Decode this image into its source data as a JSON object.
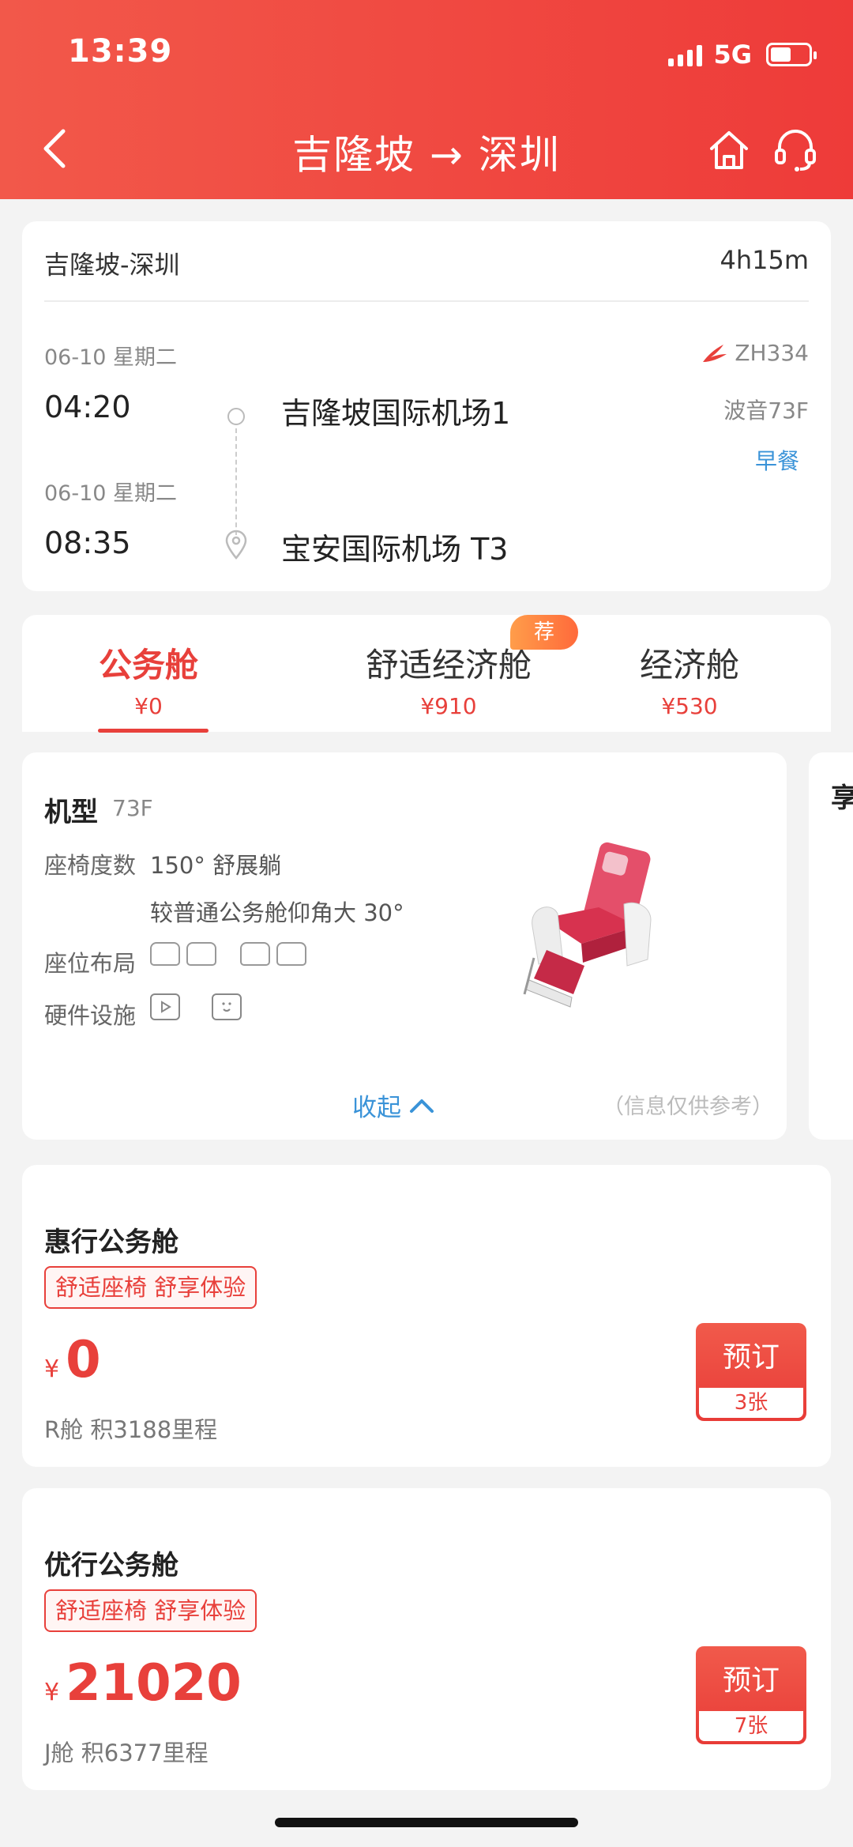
{
  "status_bar": {
    "time": "13:39",
    "network": "5G",
    "battery_level": 0.55
  },
  "nav": {
    "title": "吉隆坡 → 深圳",
    "icons": {
      "back": "chevron-left-icon",
      "home": "home-icon",
      "service": "headset-icon"
    }
  },
  "flight": {
    "route": "吉隆坡-深圳",
    "duration": "4h15m",
    "departure": {
      "date": "06-10 星期二",
      "time": "04:20",
      "airport": "吉隆坡国际机场1"
    },
    "arrival": {
      "date": "06-10 星期二",
      "time": "08:35",
      "airport": "宝安国际机场 T3"
    },
    "flight_no": "ZH334",
    "aircraft": "波音73F",
    "meal": "早餐"
  },
  "cabins": {
    "tabs": [
      {
        "name": "公务舱",
        "price": "¥0",
        "active": true
      },
      {
        "name": "舒适经济舱",
        "price": "¥910",
        "active": false
      },
      {
        "name": "经济舱",
        "price": "¥530",
        "active": false
      }
    ],
    "recommend_badge": "荐"
  },
  "cabin_info": {
    "title": "机型",
    "model": "73F",
    "recline_label": "座椅度数",
    "recline_value": "150° 舒展躺",
    "recline_note": "较普通公务舱仰角大 30°",
    "layout_label": "座位布局",
    "facilities_label": "硬件设施",
    "collapse_label": "收起",
    "ref_note": "（信息仅供参考）",
    "peek_text": "享"
  },
  "fares": [
    {
      "title": "惠行公务舱",
      "tag": "舒适座椅 舒享体验",
      "currency": "¥",
      "price": "0",
      "sub": "R舱  积3188里程",
      "book_label": "预订",
      "remaining": "3张"
    },
    {
      "title": "优行公务舱",
      "tag": "舒适座椅 舒享体验",
      "currency": "¥",
      "price": "21020",
      "sub": "J舱  积6377里程",
      "book_label": "预订",
      "remaining": "7张"
    }
  ],
  "colors": {
    "brand_red": "#e8403b",
    "header_gradient_start": "#f2584a",
    "header_gradient_end": "#ee3b39",
    "link_blue": "#3a93d8"
  }
}
